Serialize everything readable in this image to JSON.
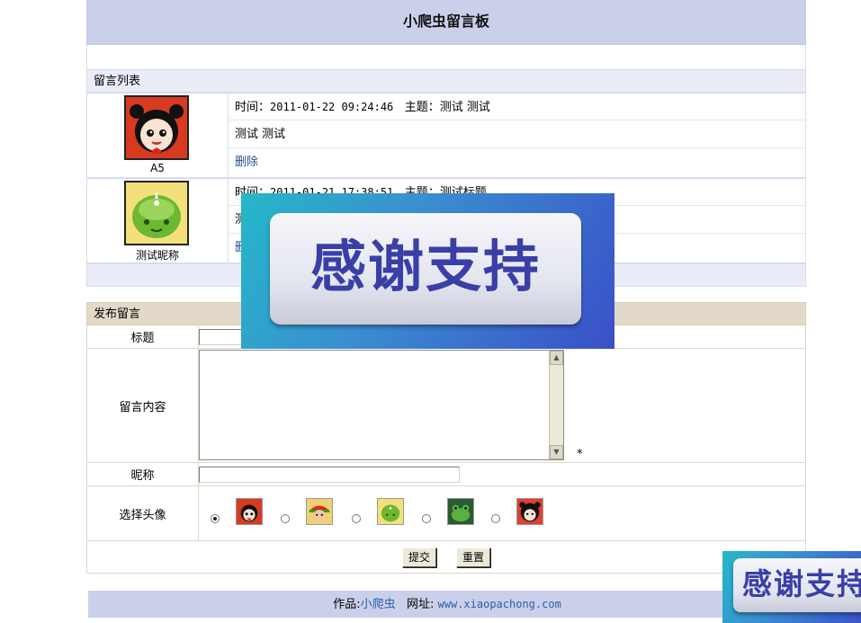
{
  "page": {
    "title": "小爬虫留言板"
  },
  "list": {
    "header": "留言列表",
    "messages": [
      {
        "nickname": "A5",
        "time_label": "时间：",
        "time": "2011-01-22 09:24:46",
        "subject_label": "主题：",
        "subject": "测试 测试",
        "content": "测试 测试",
        "delete_label": "删除"
      },
      {
        "nickname": "测试昵称",
        "time_label": "时间：",
        "time": "2011-01-21 17:38:51",
        "subject_label": "主题：",
        "subject": "测试标题",
        "content": "测",
        "delete_label": "删"
      }
    ]
  },
  "form": {
    "header": "发布留言",
    "title_label": "标题",
    "content_label": "留言内容",
    "required_mark": "*",
    "nickname_label": "昵称",
    "avatar_label": "选择头像",
    "avatars": [
      "pucca-red-icon",
      "green-hat-boy-icon",
      "green-alien-icon",
      "green-frog-icon",
      "pucca-girl-icon"
    ],
    "selected_avatar": 0,
    "submit_label": "提交",
    "reset_label": "重置"
  },
  "footer": {
    "author_label": "作品:",
    "author": "小爬虫",
    "site_label": "网址:",
    "site": "www.xiaopachong.com"
  },
  "overlays": {
    "banner_text": "感谢支持"
  },
  "colors": {
    "title_bar": "#cbd0ea",
    "list_header": "#eaecf7",
    "form_header": "#e3d9c8",
    "link": "#2a4f8f",
    "banner_text": "#3a3fa8"
  }
}
